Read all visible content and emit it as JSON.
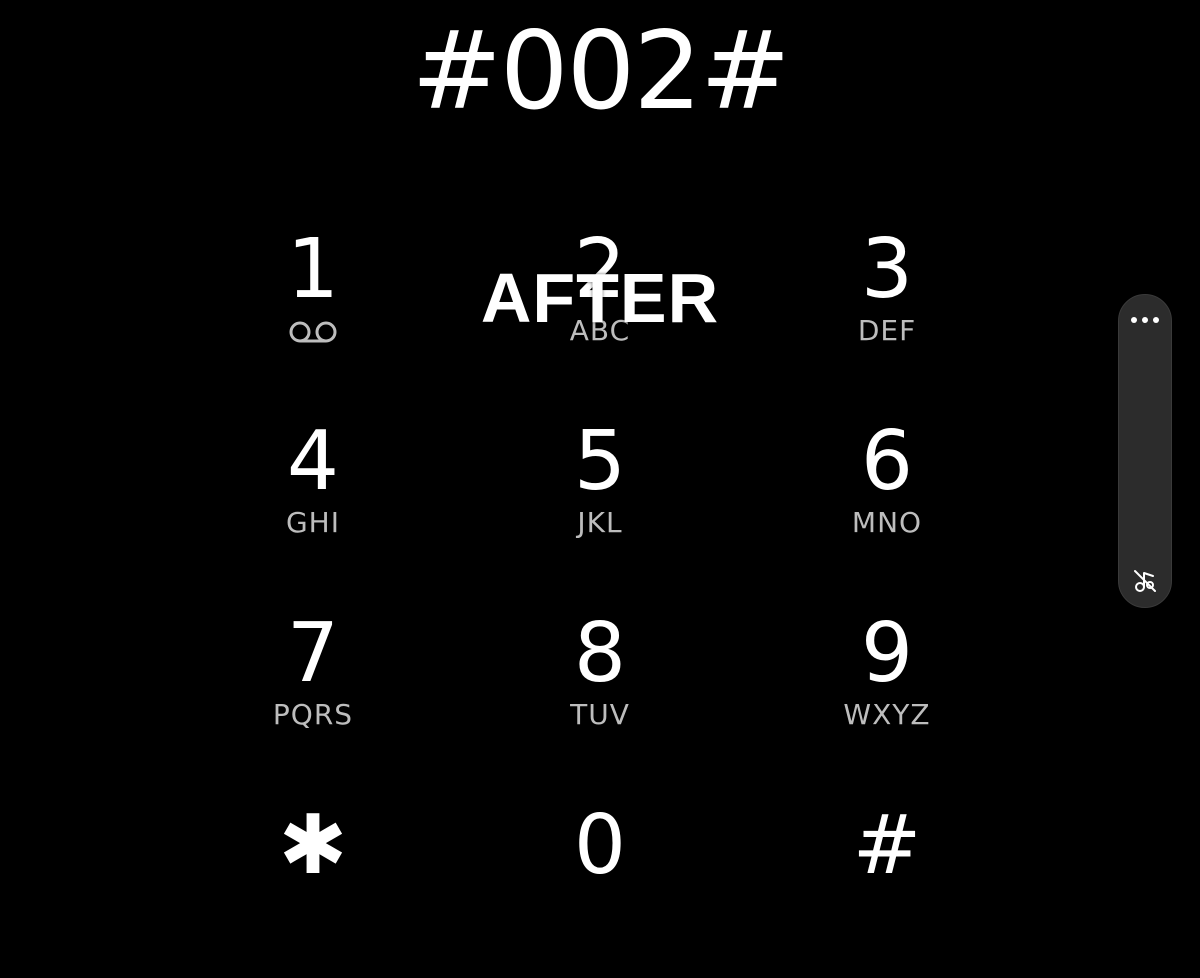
{
  "dialer": {
    "number": "#002#"
  },
  "overlay": {
    "caption": "AFTER"
  },
  "keypad": {
    "keys": [
      {
        "digit": "1",
        "letters": "",
        "icon": "voicemail-icon"
      },
      {
        "digit": "2",
        "letters": "ABC"
      },
      {
        "digit": "3",
        "letters": "DEF"
      },
      {
        "digit": "4",
        "letters": "GHI"
      },
      {
        "digit": "5",
        "letters": "JKL"
      },
      {
        "digit": "6",
        "letters": "MNO"
      },
      {
        "digit": "7",
        "letters": "PQRS"
      },
      {
        "digit": "8",
        "letters": "TUV"
      },
      {
        "digit": "9",
        "letters": "WXYZ"
      },
      {
        "digit": "✱",
        "letters": ""
      },
      {
        "digit": "0",
        "letters": ""
      },
      {
        "digit": "#",
        "letters": ""
      }
    ]
  },
  "side_panel": {
    "top_icon": "more-icon",
    "bottom_icon": "mute-music-icon"
  },
  "colors": {
    "background": "#000000",
    "text": "#ffffff",
    "letters": "#bdbdbd",
    "panel": "#2c2c2c"
  }
}
